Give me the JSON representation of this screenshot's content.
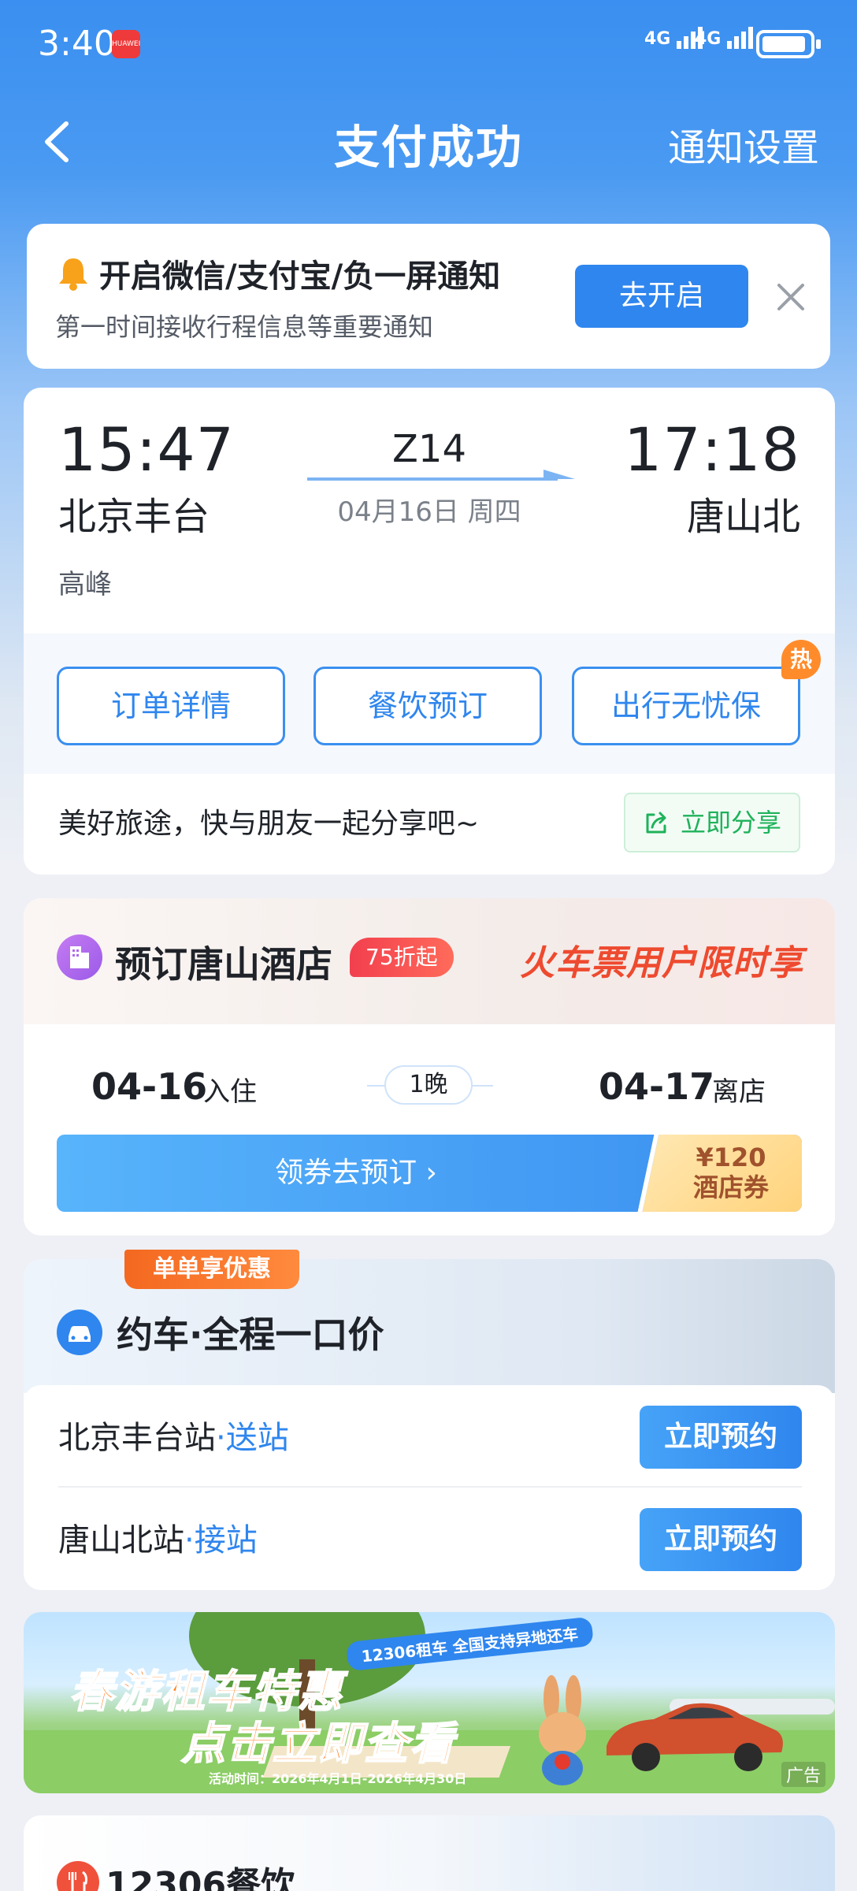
{
  "status_bar": {
    "time": "3:40",
    "app_badge": "HUAWEI",
    "signal1": "4G",
    "signal2": "4G"
  },
  "nav": {
    "title": "支付成功",
    "right": "通知设置"
  },
  "notify": {
    "title": "开启微信/支付宝/负一屏通知",
    "subtitle": "第一时间接收行程信息等重要通知",
    "open_button": "去开启"
  },
  "trip": {
    "depart_time": "15:47",
    "depart_station": "北京丰台",
    "train_no": "Z14",
    "date": "04月16日 周四",
    "arrive_time": "17:18",
    "arrive_station": "唐山北",
    "seat_class": "高峰",
    "actions": [
      "订单详情",
      "餐饮预订",
      "出行无忧保"
    ],
    "hot_badge": "热",
    "share_text": "美好旅途，快与朋友一起分享吧~",
    "share_button": "立即分享"
  },
  "hotel": {
    "title": "预订唐山酒店",
    "discount": "75折起",
    "slogan": "火车票用户限时享",
    "checkin_date": "04-16",
    "checkin_label": "入住",
    "nights": "1晚",
    "checkout_date": "04-17",
    "checkout_label": "离店",
    "coupon_cta": "领券去预订 ›",
    "coupon_amount": "¥120",
    "coupon_type": "酒店券"
  },
  "car": {
    "ribbon": "单单享优惠",
    "title": "约车·全程一口价",
    "rows": [
      {
        "station": "北京丰台站",
        "tag": "·送站",
        "button": "立即预约"
      },
      {
        "station": "唐山北站",
        "tag": "·接站",
        "button": "立即预约"
      }
    ]
  },
  "ad": {
    "pill": "12306租车 全国支持异地还车",
    "line1": "春游租车特惠",
    "line2": "点击立即查看",
    "period": "活动时间：2026年4月1日-2026年4月30日",
    "label": "广告"
  },
  "food": {
    "title": "12306餐饮"
  },
  "colors": {
    "primary": "#2f86ee",
    "hero_top": "#3a8ff0",
    "orange": "#ff7a16",
    "discount_red": "#f23f4e",
    "share_green": "#1fb25a"
  }
}
